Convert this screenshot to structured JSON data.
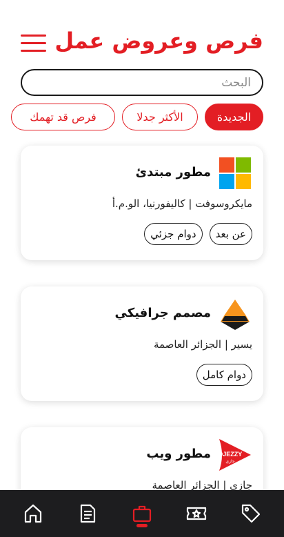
{
  "app": {
    "title": "فرص وعروض عمل"
  },
  "search": {
    "placeholder": "البحث"
  },
  "filters": [
    {
      "label": "الجديدة",
      "active": true
    },
    {
      "label": "الأكثر جدلا",
      "active": false
    },
    {
      "label": "فرص قد تهمك",
      "active": false
    }
  ],
  "jobs": [
    {
      "title": "مطور مبتدئ",
      "company": "مايكروسوفت | كاليفورنيا، الو.م.أ",
      "tags": [
        "عن بعد",
        "دوام جزئي"
      ],
      "logo": "microsoft-logo"
    },
    {
      "title": "مصمم جرافيكي",
      "company": "يسير |  الجزائر العاصمة",
      "tags": [
        "دوام كامل"
      ],
      "logo": "yassir-logo"
    },
    {
      "title": "مطور ويب",
      "company": "جازي | الجزائر العاصمة",
      "tags": [],
      "logo": "djezzy-logo",
      "logo_text": "DJEZZY",
      "logo_subtext": "جازي"
    }
  ],
  "nav": [
    {
      "icon": "home-icon",
      "active": false
    },
    {
      "icon": "document-icon",
      "active": false
    },
    {
      "icon": "briefcase-icon",
      "active": true
    },
    {
      "icon": "ticket-icon",
      "active": false
    },
    {
      "icon": "tag-icon",
      "active": false
    }
  ],
  "colors": {
    "accent": "#e31e24",
    "nav_background": "#1d1d1f",
    "nav_icon": "#ffffff"
  }
}
